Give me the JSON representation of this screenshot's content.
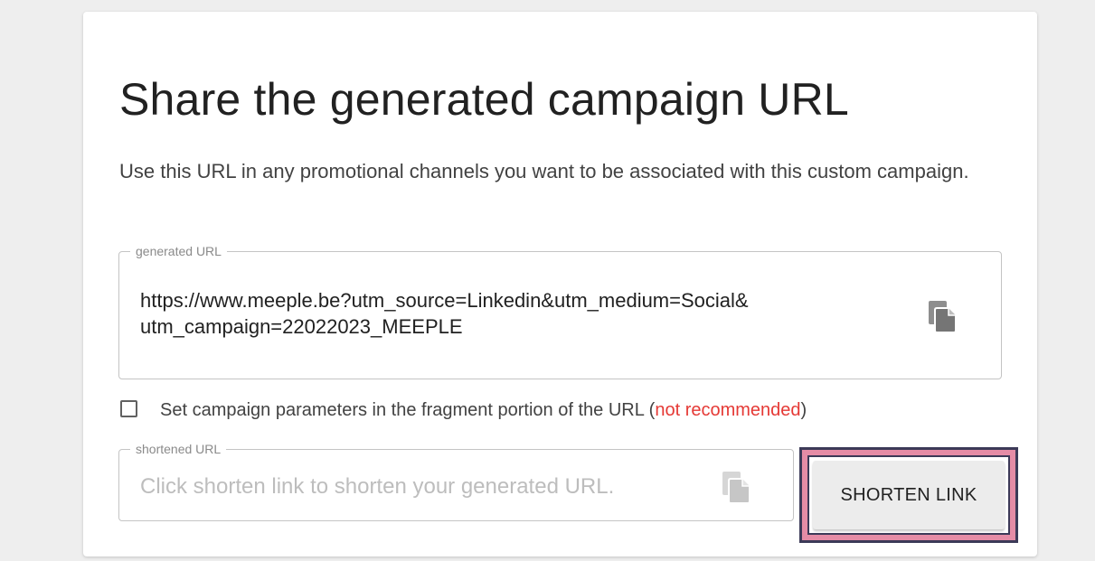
{
  "card": {
    "title": "Share the generated campaign URL",
    "description": "Use this URL in any promotional channels you want to be associated with this custom campaign."
  },
  "generated_url": {
    "legend": "generated URL",
    "value_line1": "https://www.meeple.be?utm_source=Linkedin&utm_medium=Social&",
    "value_line2": "utm_campaign=22022023_MEEPLE",
    "copy_icon": "copy-icon"
  },
  "fragment_option": {
    "checked": false,
    "label_prefix": "Set campaign parameters in the fragment portion of the URL (",
    "label_warning": "not recommended",
    "label_suffix": ")"
  },
  "shortened_url": {
    "legend": "shortened URL",
    "placeholder": "Click shorten link to shorten your generated URL.",
    "copy_icon": "copy-icon"
  },
  "shorten_button": {
    "label": "SHORTEN LINK"
  },
  "colors": {
    "warning": "#e53935",
    "highlight_fill": "#e58ca6",
    "highlight_border": "#3c3a58"
  }
}
